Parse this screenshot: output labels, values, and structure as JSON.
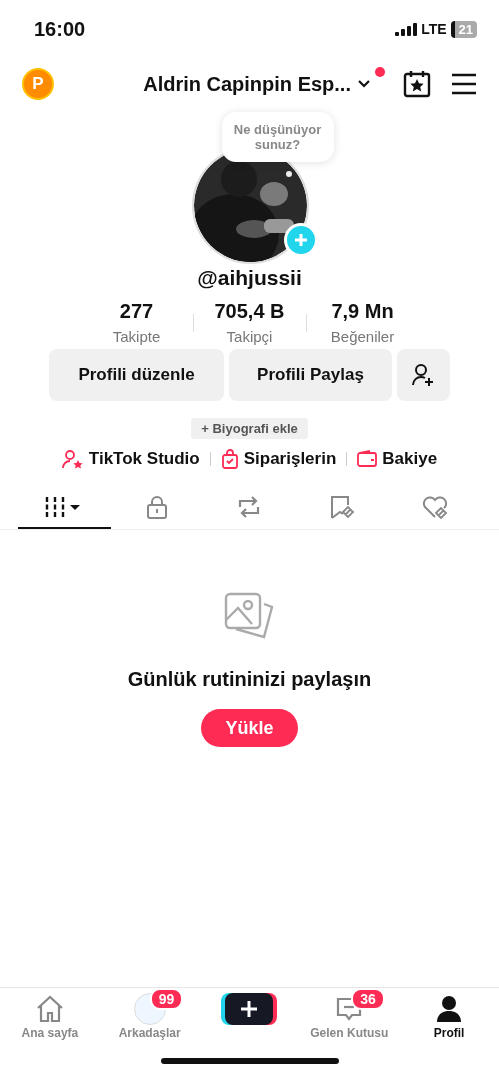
{
  "status_bar": {
    "time": "16:00",
    "network": "LTE",
    "battery": "21"
  },
  "header": {
    "coin": "P",
    "title": "Aldrin Capinpin Esp...",
    "has_notification": true
  },
  "avatar": {
    "bubble": "Ne düşünüyorsunuz?"
  },
  "username": "@aihjussii",
  "stats": [
    {
      "value": "277",
      "label": "Takipte"
    },
    {
      "value": "705,4 B",
      "label": "Takipçi"
    },
    {
      "value": "7,9 Mn",
      "label": "Beğeniler"
    }
  ],
  "buttons": [
    "Profili düzenle",
    "Profili Paylaş"
  ],
  "bio_button": "+ Biyografi ekle",
  "links": [
    {
      "kind": "studio",
      "label": "TikTok Studio"
    },
    {
      "kind": "orders",
      "label": "Siparişlerin"
    },
    {
      "kind": "balance",
      "label": "Bakiye"
    }
  ],
  "tabs": [
    {
      "kind": "videos",
      "selected": true
    },
    {
      "kind": "private",
      "selected": false
    },
    {
      "kind": "reposts",
      "selected": false
    },
    {
      "kind": "saved",
      "selected": false
    },
    {
      "kind": "liked",
      "selected": false
    }
  ],
  "empty": {
    "title": "Günlük rutininizi paylaşın",
    "button": "Yükle"
  },
  "nav": [
    {
      "kind": "home",
      "label": "Ana sayfa",
      "selected": false
    },
    {
      "kind": "friends",
      "label": "Arkadaşlar",
      "badge": "99",
      "selected": false
    },
    {
      "kind": "create"
    },
    {
      "kind": "inbox",
      "label": "Gelen Kutusu",
      "badge": "36",
      "selected": false
    },
    {
      "kind": "profile",
      "label": "Profil",
      "selected": true
    }
  ]
}
